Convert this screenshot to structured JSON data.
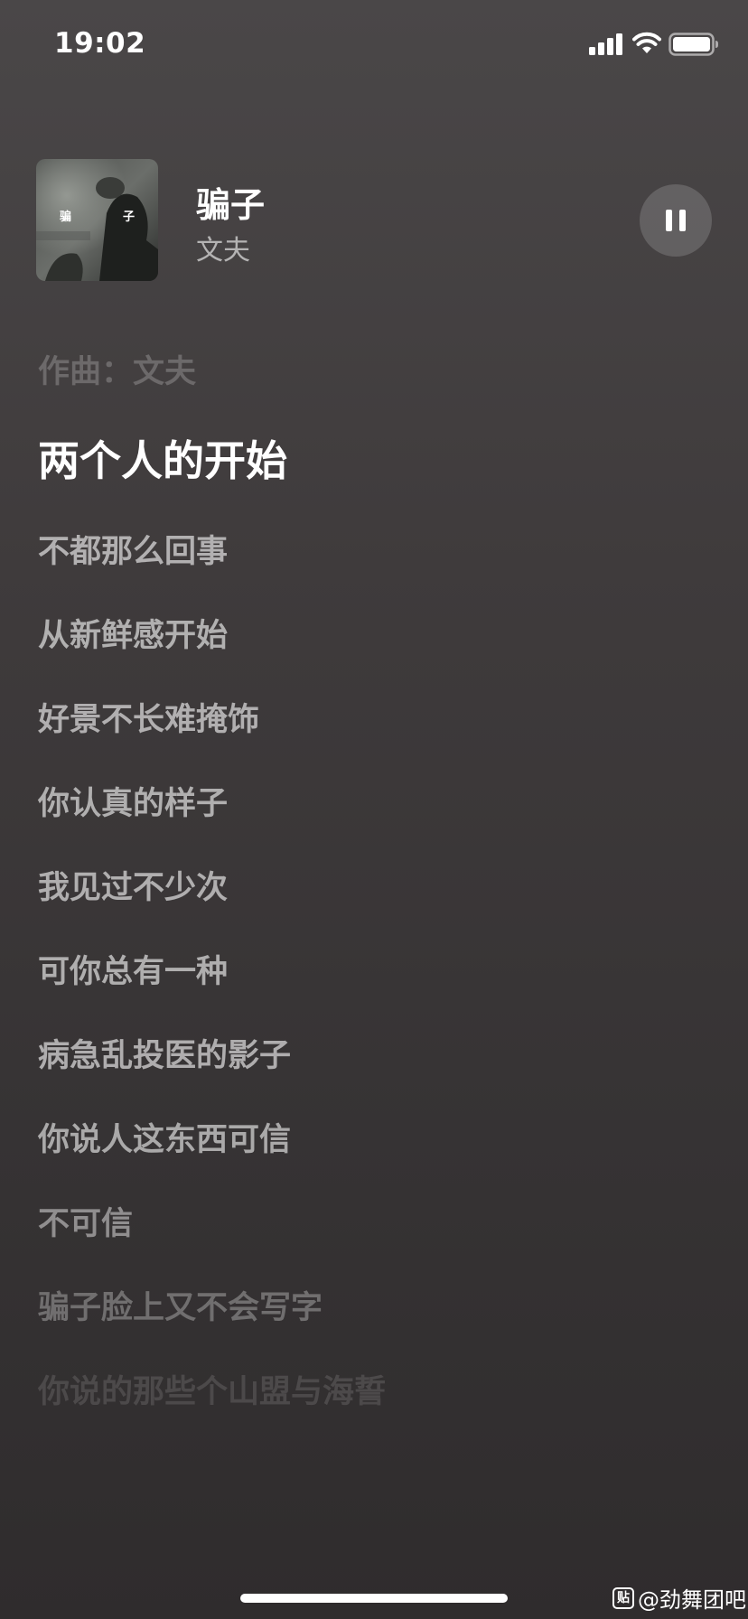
{
  "status_bar": {
    "time": "19:02",
    "icons": [
      "signal-icon",
      "wifi-icon",
      "battery-icon"
    ]
  },
  "now_playing": {
    "title": "骗子",
    "artist": "文夫",
    "album_art_text": [
      "骗",
      "子"
    ],
    "pause_icon": "pause-icon"
  },
  "lyrics": {
    "lines": [
      {
        "text": "作曲：文夫",
        "opacity": 0.22
      },
      {
        "text": "两个人的开始",
        "opacity": 1.0,
        "current": true
      },
      {
        "text": "不都那么回事",
        "opacity": 0.6
      },
      {
        "text": "从新鲜感开始",
        "opacity": 0.6
      },
      {
        "text": "好景不长难掩饰",
        "opacity": 0.6
      },
      {
        "text": "你认真的样子",
        "opacity": 0.6
      },
      {
        "text": "我见过不少次",
        "opacity": 0.6
      },
      {
        "text": "可你总有一种",
        "opacity": 0.6
      },
      {
        "text": "病急乱投医的影子",
        "opacity": 0.6
      },
      {
        "text": "你说人这东西可信",
        "opacity": 0.58
      },
      {
        "text": "不可信",
        "opacity": 0.45
      },
      {
        "text": "骗子脸上又不会写字",
        "opacity": 0.3
      },
      {
        "text": "你说的那些个山盟与海誓",
        "opacity": 0.13
      }
    ]
  },
  "watermark": {
    "icon_char": "贴",
    "text": "@劲舞团吧"
  },
  "colors": {
    "background_top": "#4a4748",
    "background_bottom": "#2f2c2d",
    "text": "#ffffff"
  }
}
